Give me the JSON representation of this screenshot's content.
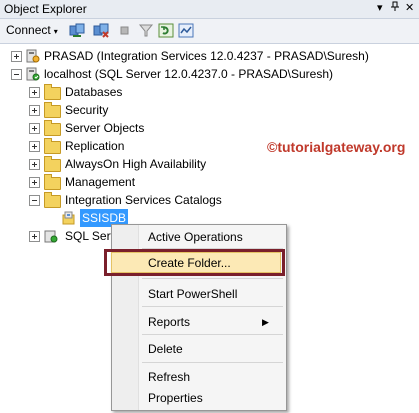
{
  "window": {
    "title": "Object Explorer",
    "pin_glyph": "▾",
    "close_glyph": "✕"
  },
  "toolbar": {
    "connect_label": "Connect",
    "connect_arrow": "▾"
  },
  "tree": {
    "prasad_label": "PRASAD (Integration Services 12.0.4237 - PRASAD\\Suresh)",
    "localhost_label": "localhost (SQL Server 12.0.4237.0 - PRASAD\\Suresh)",
    "databases": "Databases",
    "security": "Security",
    "server_objects": "Server Objects",
    "replication": "Replication",
    "alwayson": "AlwaysOn High Availability",
    "management": "Management",
    "is_catalogs": "Integration Services Catalogs",
    "ssisdb": "SSISDB",
    "sql_server_agent": "SQL Serv"
  },
  "watermark": "©tutorialgateway.org",
  "context_menu": {
    "active_operations": "Active Operations",
    "create_folder": "Create Folder...",
    "start_powershell": "Start PowerShell",
    "reports": "Reports",
    "delete": "Delete",
    "refresh": "Refresh",
    "properties": "Properties",
    "submenu_arrow": "▶"
  },
  "colors": {
    "selection": "#3399ff",
    "highlight_border": "#7a1f2b",
    "watermark": "#c0392b"
  }
}
